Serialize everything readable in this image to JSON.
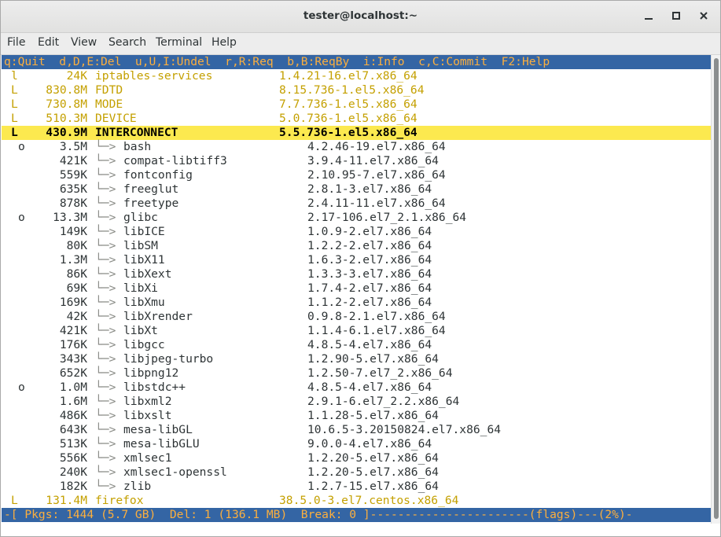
{
  "window": {
    "title": "tester@localhost:~",
    "controls": {
      "minimize": "minimize-icon",
      "maximize": "maximize-icon",
      "close": "close-icon"
    }
  },
  "menu": [
    "File",
    "Edit",
    "View",
    "Search",
    "Terminal",
    "Help"
  ],
  "header": "q:Quit  d,D,E:Del  u,U,I:Undel  r,R:Req  b,B:ReqBy  i:Info  c,C:Commit  F2:Help",
  "tree_glyph": "└─> ",
  "top_packages": [
    {
      "flag": "l",
      "size": "24K",
      "name": "iptables-services",
      "version": "1.4.21-16.el7.x86_64"
    },
    {
      "flag": "L",
      "size": "830.8M",
      "name": "FDTD",
      "version": "8.15.736-1.el5.x86_64"
    },
    {
      "flag": "L",
      "size": "730.8M",
      "name": "MODE",
      "version": "7.7.736-1.el5.x86_64"
    },
    {
      "flag": "L",
      "size": "510.3M",
      "name": "DEVICE",
      "version": "5.0.736-1.el5.x86_64"
    }
  ],
  "selected": {
    "flag": "L",
    "size": "430.9M",
    "name": "INTERCONNECT",
    "version": "5.5.736-1.el5.x86_64"
  },
  "dependencies": [
    {
      "flag": "o",
      "size": "3.5M",
      "name": "bash",
      "version": "4.2.46-19.el7.x86_64"
    },
    {
      "flag": "",
      "size": "421K",
      "name": "compat-libtiff3",
      "version": "3.9.4-11.el7.x86_64"
    },
    {
      "flag": "",
      "size": "559K",
      "name": "fontconfig",
      "version": "2.10.95-7.el7.x86_64"
    },
    {
      "flag": "",
      "size": "635K",
      "name": "freeglut",
      "version": "2.8.1-3.el7.x86_64"
    },
    {
      "flag": "",
      "size": "878K",
      "name": "freetype",
      "version": "2.4.11-11.el7.x86_64"
    },
    {
      "flag": "o",
      "size": "13.3M",
      "name": "glibc",
      "version": "2.17-106.el7_2.1.x86_64"
    },
    {
      "flag": "",
      "size": "149K",
      "name": "libICE",
      "version": "1.0.9-2.el7.x86_64"
    },
    {
      "flag": "",
      "size": "80K",
      "name": "libSM",
      "version": "1.2.2-2.el7.x86_64"
    },
    {
      "flag": "",
      "size": "1.3M",
      "name": "libX11",
      "version": "1.6.3-2.el7.x86_64"
    },
    {
      "flag": "",
      "size": "86K",
      "name": "libXext",
      "version": "1.3.3-3.el7.x86_64"
    },
    {
      "flag": "",
      "size": "69K",
      "name": "libXi",
      "version": "1.7.4-2.el7.x86_64"
    },
    {
      "flag": "",
      "size": "169K",
      "name": "libXmu",
      "version": "1.1.2-2.el7.x86_64"
    },
    {
      "flag": "",
      "size": "42K",
      "name": "libXrender",
      "version": "0.9.8-2.1.el7.x86_64"
    },
    {
      "flag": "",
      "size": "421K",
      "name": "libXt",
      "version": "1.1.4-6.1.el7.x86_64"
    },
    {
      "flag": "",
      "size": "176K",
      "name": "libgcc",
      "version": "4.8.5-4.el7.x86_64"
    },
    {
      "flag": "",
      "size": "343K",
      "name": "libjpeg-turbo",
      "version": "1.2.90-5.el7.x86_64"
    },
    {
      "flag": "",
      "size": "652K",
      "name": "libpng12",
      "version": "1.2.50-7.el7_2.x86_64"
    },
    {
      "flag": "o",
      "size": "1.0M",
      "name": "libstdc++",
      "version": "4.8.5-4.el7.x86_64"
    },
    {
      "flag": "",
      "size": "1.6M",
      "name": "libxml2",
      "version": "2.9.1-6.el7_2.2.x86_64"
    },
    {
      "flag": "",
      "size": "486K",
      "name": "libxslt",
      "version": "1.1.28-5.el7.x86_64"
    },
    {
      "flag": "",
      "size": "643K",
      "name": "mesa-libGL",
      "version": "10.6.5-3.20150824.el7.x86_64"
    },
    {
      "flag": "",
      "size": "513K",
      "name": "mesa-libGLU",
      "version": "9.0.0-4.el7.x86_64"
    },
    {
      "flag": "",
      "size": "556K",
      "name": "xmlsec1",
      "version": "1.2.20-5.el7.x86_64"
    },
    {
      "flag": "",
      "size": "240K",
      "name": "xmlsec1-openssl",
      "version": "1.2.20-5.el7.x86_64"
    },
    {
      "flag": "",
      "size": "182K",
      "name": "zlib",
      "version": "1.2.7-15.el7.x86_64"
    }
  ],
  "bottom_packages": [
    {
      "flag": "L",
      "size": "131.4M",
      "name": "firefox",
      "version": "38.5.0-3.el7.centos.x86_64"
    }
  ],
  "status_line": "-[ Pkgs: 1444 (5.7 GB)  Del: 1 (136.1 MB)  Break: 0 ]-----------------------(flags)---(2%)-",
  "colors": {
    "header_bg": "#3465a4",
    "header_fg": "#fcaf3e",
    "package_fg": "#c4a000",
    "selected_bg": "#fce94f",
    "dependency_fg": "#2e3436"
  }
}
